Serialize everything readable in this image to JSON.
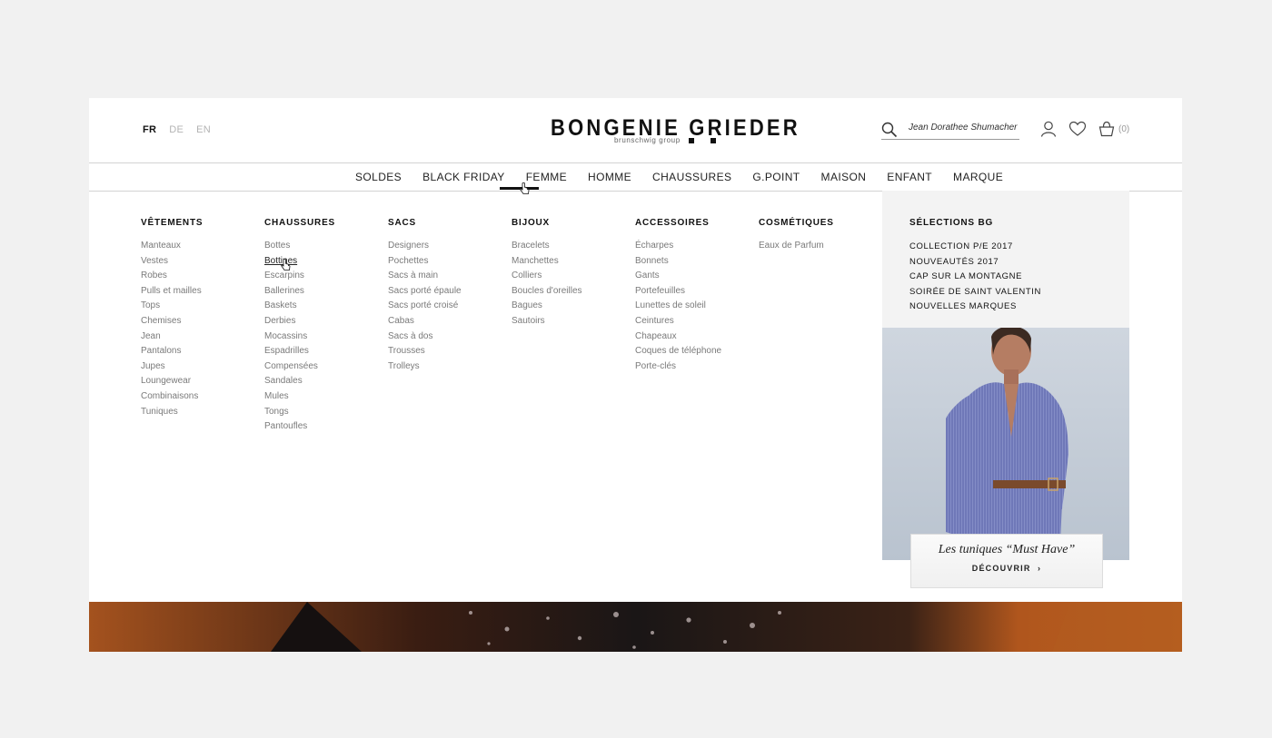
{
  "languages": [
    {
      "code": "FR",
      "active": true
    },
    {
      "code": "DE",
      "active": false
    },
    {
      "code": "EN",
      "active": false
    }
  ],
  "logo": {
    "brand": "BONGENIE GRIEDER",
    "sub": "brunschwig group"
  },
  "search": {
    "value": "Jean Dorathee Shumacher"
  },
  "cart": {
    "count": "(0)"
  },
  "icons": {
    "search": "search-icon",
    "account": "user-icon",
    "wishlist": "heart-icon",
    "cart": "basket-icon"
  },
  "nav": {
    "items": [
      "SOLDES",
      "BLACK FRIDAY",
      "FEMME",
      "HOMME",
      "CHAUSSURES",
      "G.POINT",
      "MAISON",
      "ENFANT",
      "MARQUE"
    ],
    "active": "FEMME"
  },
  "menu": {
    "columns": [
      {
        "title": "VÊTEMENTS",
        "items": [
          "Manteaux",
          "Vestes",
          "Robes",
          "Pulls et mailles",
          "Tops",
          "Chemises",
          "Jean",
          "Pantalons",
          "Jupes",
          "Loungewear",
          "Combinaisons",
          "Tuniques"
        ]
      },
      {
        "title": "CHAUSSURES",
        "items": [
          "Bottes",
          "Bottines",
          "Escarpins",
          "Ballerines",
          "Baskets",
          "Derbies",
          "Mocassins",
          "Espadrilles",
          "Compensées",
          "Sandales",
          "Mules",
          "Tongs",
          "Pantoufles"
        ]
      },
      {
        "title": "SACS",
        "items": [
          "Designers",
          "Pochettes",
          "Sacs à main",
          "Sacs porté épaule",
          "Sacs porté croisé",
          "Cabas",
          "Sacs à dos",
          "Trousses",
          "Trolleys"
        ]
      },
      {
        "title": "BIJOUX",
        "items": [
          "Bracelets",
          "Manchettes",
          "Colliers",
          "Boucles d'oreilles",
          "Bagues",
          "Sautoirs"
        ]
      },
      {
        "title": "ACCESSOIRES",
        "items": [
          "Écharpes",
          "Bonnets",
          "Gants",
          "Portefeuilles",
          "Lunettes de soleil",
          "Ceintures",
          "Chapeaux",
          "Coques de téléphone",
          "Porte-clés"
        ]
      },
      {
        "title": "COSMÉTIQUES",
        "items": [
          "Eaux de Parfum"
        ]
      }
    ],
    "hovered": "Bottines"
  },
  "selections": {
    "title": "SÉLECTIONS BG",
    "items": [
      "COLLECTION P/E 2017",
      "NOUVEAUTÉS 2017",
      "CAP SUR LA MONTAGNE",
      "SOIRÉE DE SAINT VALENTIN",
      "NOUVELLES MARQUES"
    ]
  },
  "promo": {
    "title": "Les tuniques “Must Have”",
    "cta": "DÉCOUVRIR",
    "cta_icon": "chevron-right-icon"
  },
  "colors": {
    "background": "#f1f1f1",
    "accent": "#111111",
    "muted_text": "#7a7a7a",
    "panel": "#f3f3f3"
  }
}
